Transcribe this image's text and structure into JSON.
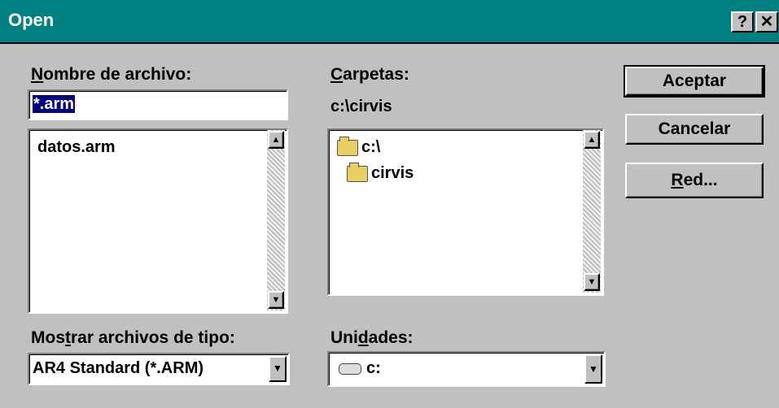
{
  "window": {
    "title": "Open",
    "help_glyph": "?",
    "close_glyph": "✕"
  },
  "filename": {
    "label": "Nombre de archivo:",
    "value": "*.arm",
    "files": [
      "datos.arm"
    ]
  },
  "folders": {
    "label": "Carpetas:",
    "current_path": "c:\\cirvis",
    "items": [
      "c:\\",
      "cirvis"
    ]
  },
  "buttons": {
    "accept": "Aceptar",
    "cancel": "Cancelar",
    "network": "Red..."
  },
  "file_type": {
    "label": "Mostrar archivos de tipo:",
    "selected": "AR4 Standard (*.ARM)"
  },
  "drives": {
    "label": "Unidades:",
    "selected": "c:"
  },
  "icons": {
    "folder": "folder-icon",
    "drive": "drive-icon",
    "scroll_up": "▲",
    "scroll_down": "▼",
    "dropdown": "▼"
  }
}
